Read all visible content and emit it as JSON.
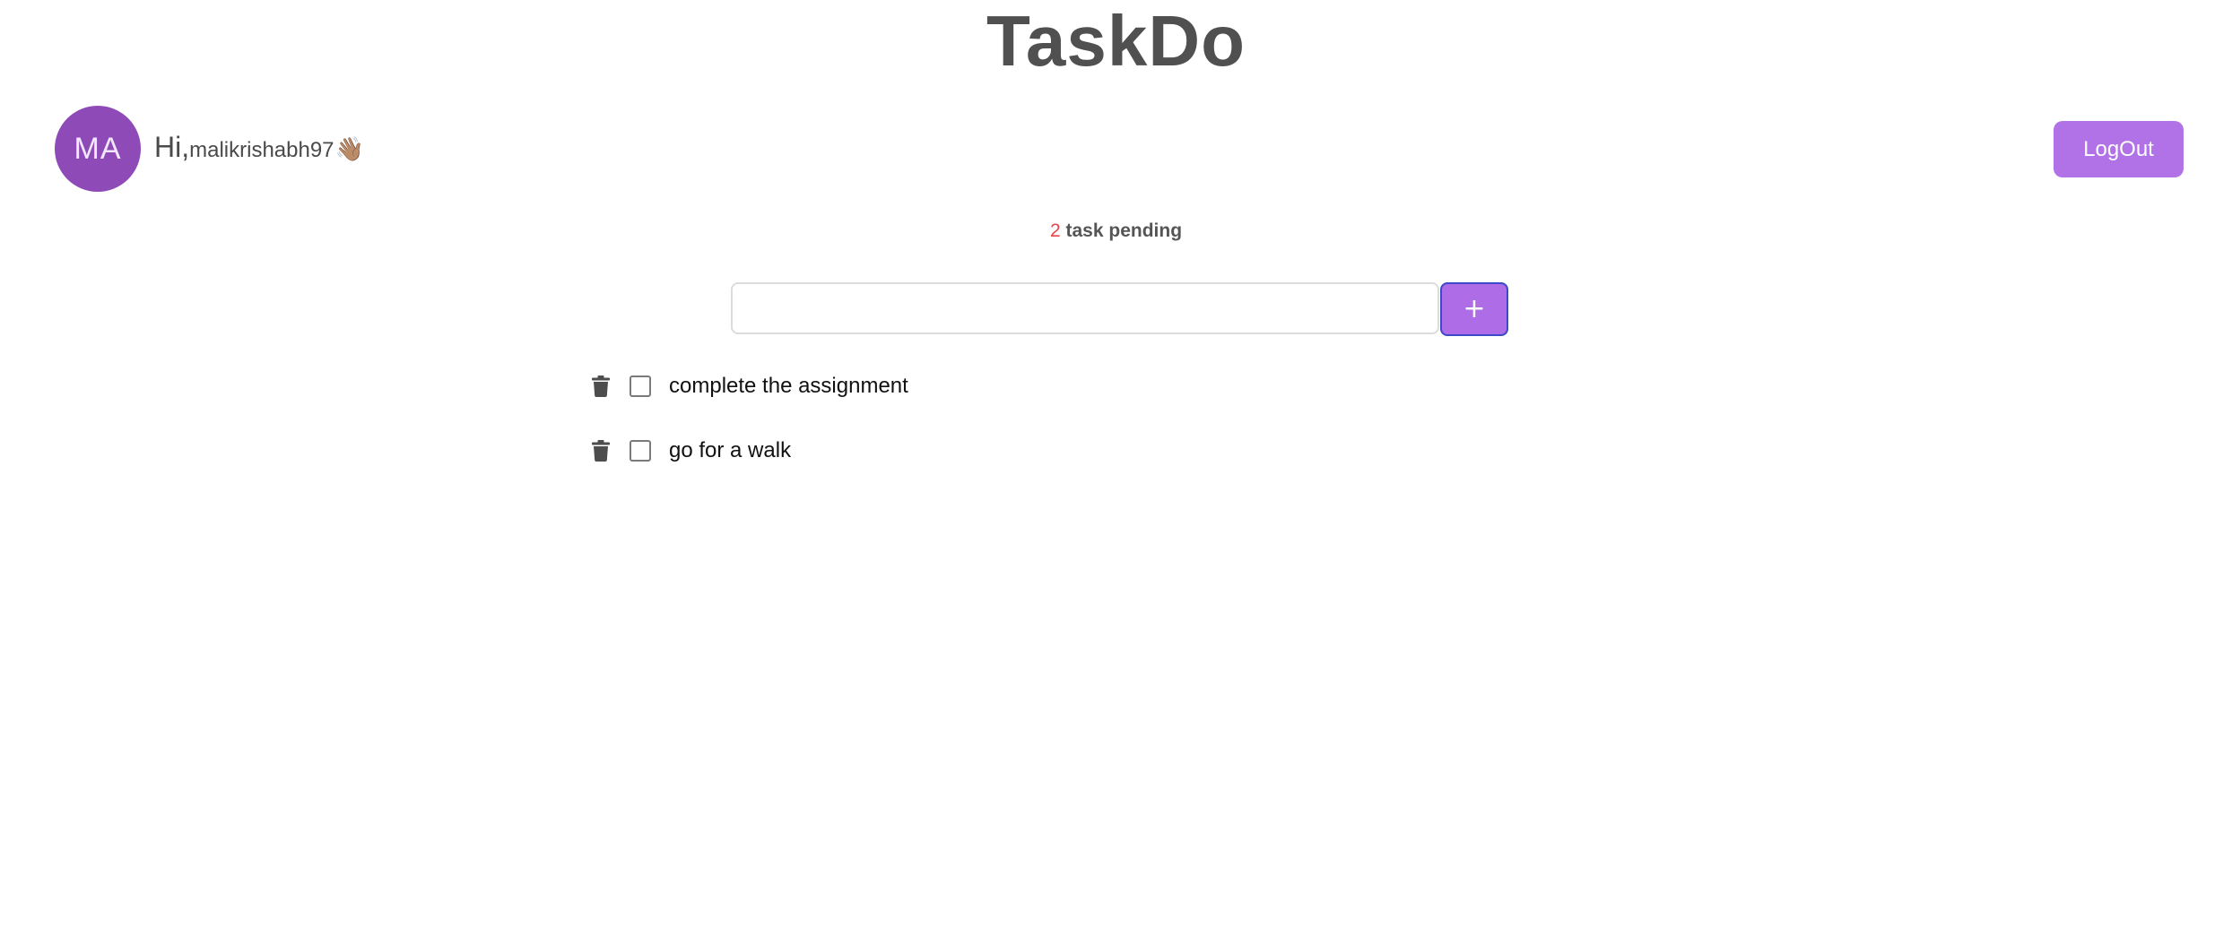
{
  "app": {
    "title": "TaskDo"
  },
  "user": {
    "initials": "MA",
    "greeting": "Hi,",
    "username": "malikrishabh97",
    "wave_emoji": "👋🏽"
  },
  "header": {
    "logout_label": "LogOut"
  },
  "status": {
    "pending_count": "2",
    "pending_label": "task pending"
  },
  "add_task": {
    "input_value": "",
    "button_label": "+"
  },
  "tasks": [
    {
      "text": "complete the assignment",
      "done": false
    },
    {
      "text": "go for a walk",
      "done": false
    }
  ],
  "colors": {
    "accent": "#b072e6",
    "avatar": "#8e4bb8",
    "pending_count": "#e8454b",
    "title": "#505050"
  },
  "icons": {
    "delete": "trash-icon"
  }
}
